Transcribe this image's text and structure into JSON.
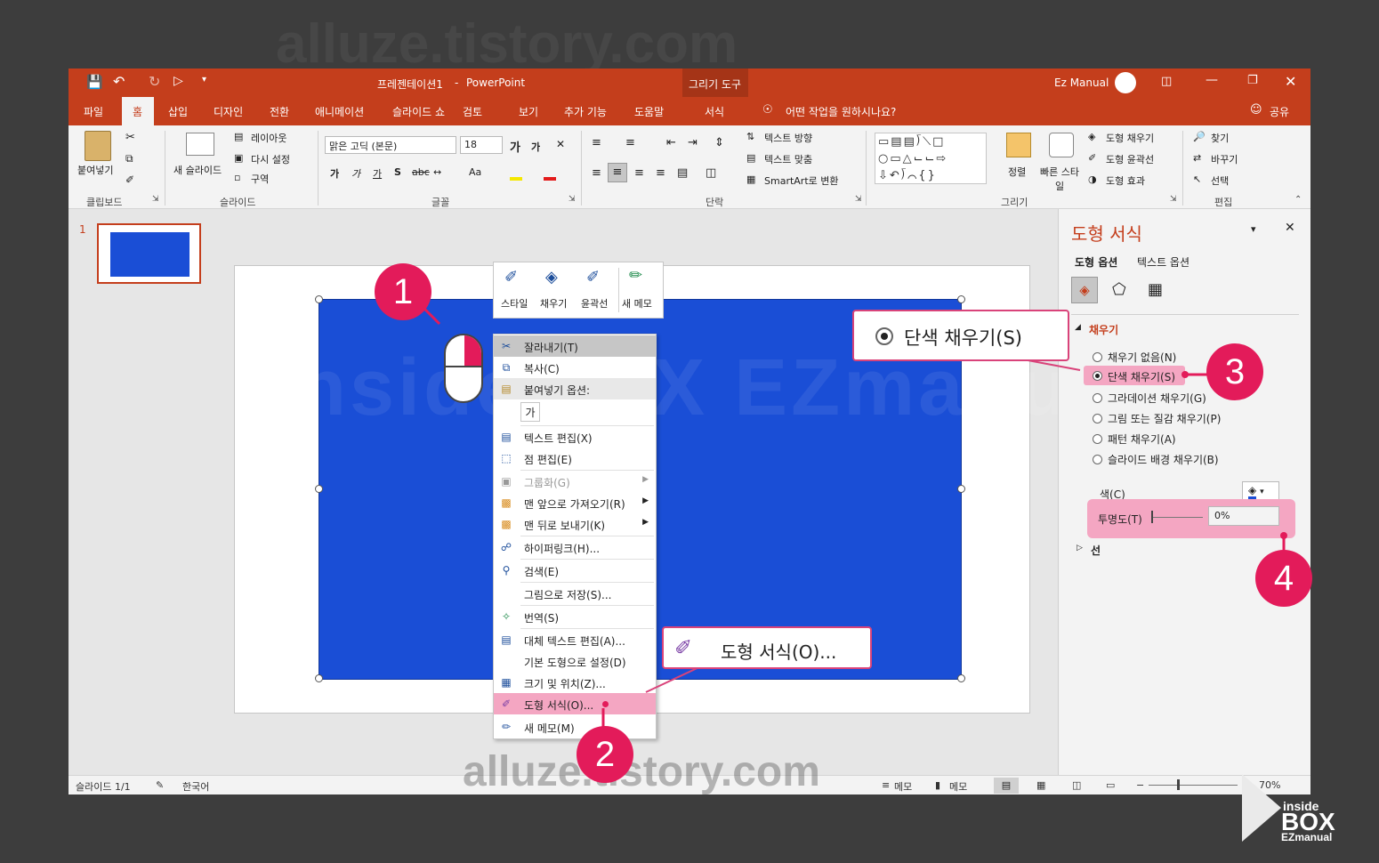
{
  "watermark_top": "alluze.tistory.com",
  "watermark_mid": "insideBOX EZmanual",
  "watermark_bot": "alluze.tistory.com",
  "titlebar": {
    "doc_title": "프레젠테이션1",
    "separator": "-",
    "app_name": "PowerPoint",
    "context_tab_group": "그리기 도구",
    "user": "Ez Manual"
  },
  "tabs": [
    "파일",
    "홈",
    "삽입",
    "디자인",
    "전환",
    "애니메이션",
    "슬라이드 쇼",
    "검토",
    "보기",
    "추가 기능",
    "도움말",
    "서식"
  ],
  "active_tab": "홈",
  "tell_me": "어떤 작업을 원하시나요?",
  "share": "공유",
  "ribbon": {
    "clipboard": {
      "paste": "붙여넣기",
      "group": "클립보드"
    },
    "slides": {
      "new_slide": "새 슬라이드",
      "layout": "레이아웃",
      "reset": "다시 설정",
      "section": "구역",
      "group": "슬라이드"
    },
    "font": {
      "font_name": "맑은 고딕 (본문)",
      "font_size": "18",
      "group": "글꼴"
    },
    "paragraph": {
      "group": "단락",
      "text_direction": "텍스트 방향",
      "align_text": "텍스트 맞춤",
      "smartart": "SmartArt로 변환"
    },
    "drawing": {
      "arrange": "정렬",
      "quick_styles": "빠른 스타일",
      "shape_fill": "도형 채우기",
      "shape_outline": "도형 윤곽선",
      "shape_effects": "도형 효과",
      "group": "그리기"
    },
    "editing": {
      "find": "찾기",
      "replace": "바꾸기",
      "select": "선택",
      "group": "편집"
    }
  },
  "thumbnail_number": "1",
  "mini_toolbar": [
    "스타일",
    "채우기",
    "윤곽선",
    "새 메모"
  ],
  "context_menu": [
    {
      "label": "잘라내기(T)",
      "icon": "scissors-icon",
      "highlight": true
    },
    {
      "label": "복사(C)",
      "icon": "copy-icon"
    },
    {
      "label": "붙여넣기 옵션:",
      "icon": "paste-icon",
      "header": true
    },
    {
      "label": "텍스트 편집(X)",
      "icon": "text-edit-icon"
    },
    {
      "label": "점 편집(E)",
      "icon": "edit-points-icon"
    },
    {
      "label": "그룹화(G)",
      "icon": "group-icon",
      "disabled": true,
      "submenu": true
    },
    {
      "label": "맨 앞으로 가져오기(R)",
      "icon": "bring-front-icon",
      "submenu": true
    },
    {
      "label": "맨 뒤로 보내기(K)",
      "icon": "send-back-icon",
      "submenu": true
    },
    {
      "label": "하이퍼링크(H)...",
      "icon": "hyperlink-icon"
    },
    {
      "label": "검색(E)",
      "icon": "search-icon"
    },
    {
      "label": "그림으로 저장(S)...",
      "icon": ""
    },
    {
      "label": "번역(S)",
      "icon": "translate-icon"
    },
    {
      "label": "대체 텍스트 편집(A)...",
      "icon": "alt-text-icon"
    },
    {
      "label": "기본 도형으로 설정(D)",
      "icon": ""
    },
    {
      "label": "크기 및 위치(Z)...",
      "icon": "size-icon"
    },
    {
      "label": "도형 서식(O)...",
      "icon": "format-shape-icon",
      "pink": true
    },
    {
      "label": "새 메모(M)",
      "icon": "comment-icon"
    }
  ],
  "paste_option_glyph": "가",
  "callouts": {
    "format_shape": "도형 서식(O)...",
    "solid_fill": "단색 채우기(S)"
  },
  "steps": [
    "1",
    "2",
    "3",
    "4"
  ],
  "format_pane": {
    "title": "도형 서식",
    "tab_shape": "도형 옵션",
    "tab_text": "텍스트 옵션",
    "fill_section": "채우기",
    "options": [
      "채우기 없음(N)",
      "단색 채우기(S)",
      "그라데이션 채우기(G)",
      "그림 또는 질감 채우기(P)",
      "패턴 채우기(A)",
      "슬라이드 배경 채우기(B)"
    ],
    "selected_option_index": 1,
    "color_label": "색(C)",
    "transparency_label": "투명도(T)",
    "transparency_value": "0%",
    "line_section": "선"
  },
  "status": {
    "slide": "슬라이드 1/1",
    "language": "한국어",
    "notes": "메모",
    "comments": "메모",
    "zoom": "70%"
  },
  "logo": {
    "line1": "inside",
    "line2": "BOX",
    "line3": "EZmanual"
  },
  "colors": {
    "accent": "#c43e1c",
    "slide_fill": "#1a4ed6",
    "pink": "#e31b5a"
  }
}
